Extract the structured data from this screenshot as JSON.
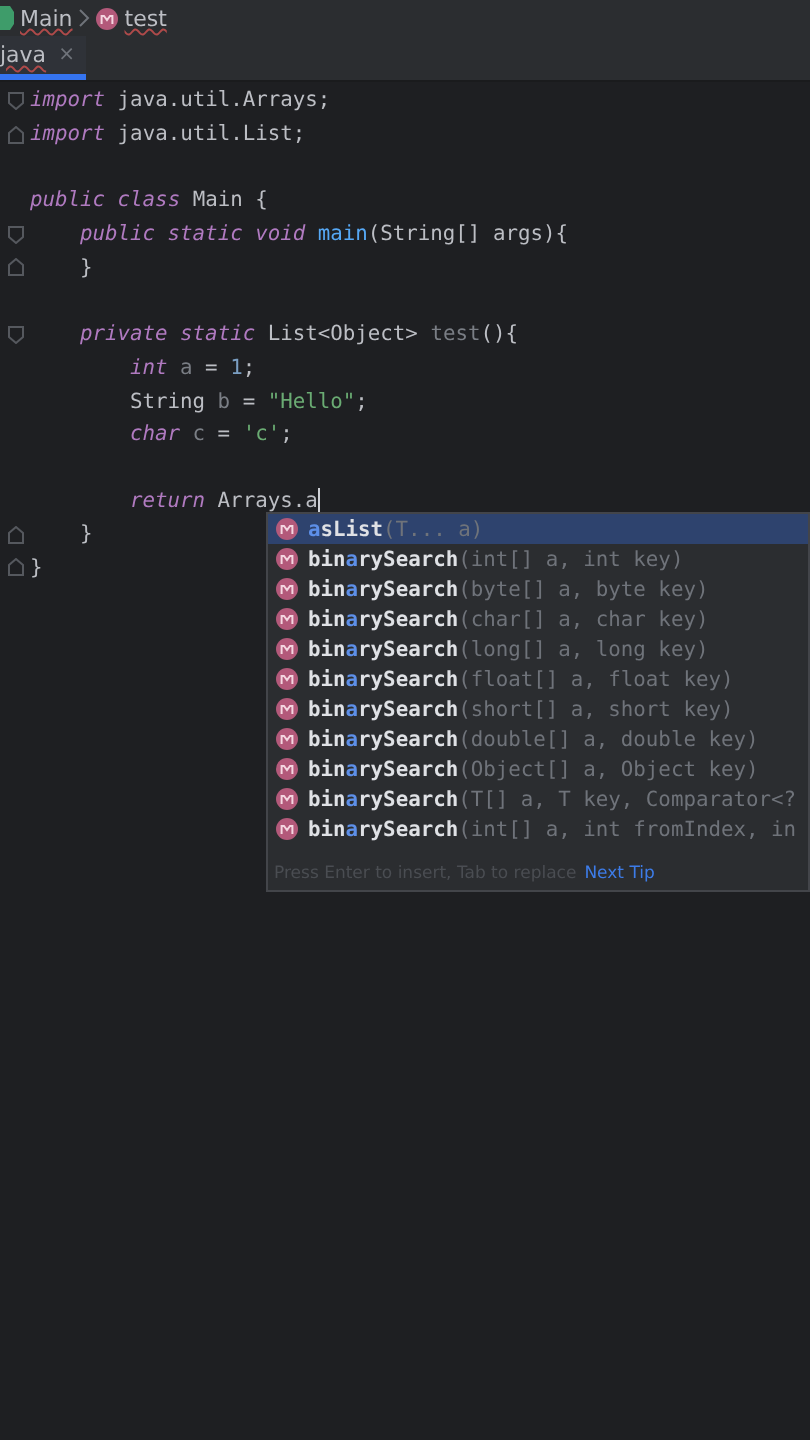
{
  "breadcrumbs": [
    {
      "label": "Main"
    },
    {
      "label": "test"
    }
  ],
  "tabs": [
    {
      "label": "java",
      "close": "×",
      "selected": true
    }
  ],
  "code_lines": [
    {
      "kind": "opener",
      "tokens": [
        {
          "kind": "kw",
          "text": "import"
        },
        {
          "kind": "plain",
          "text": " java.util.Arrays;"
        }
      ]
    },
    {
      "kind": "closer",
      "tokens": [
        {
          "kind": "kw",
          "text": "import"
        },
        {
          "kind": "plain",
          "text": " java.util.List;"
        }
      ]
    },
    {
      "kind": "line",
      "blank_before": true,
      "tokens": [
        {
          "kind": "kw",
          "text": "public class"
        },
        {
          "kind": "plain",
          "text": " Main {"
        }
      ],
      "children": [
        {
          "kind": "opener",
          "tokens": [
            {
              "kind": "kw",
              "text": "public static void "
            },
            {
              "kind": "fn",
              "text": "main"
            },
            {
              "kind": "plain",
              "text": "(String[] args){"
            }
          ]
        },
        {
          "kind": "closer",
          "tokens": [
            {
              "kind": "plain",
              "text": "}"
            }
          ]
        },
        {
          "kind": "opener",
          "blank_before": true,
          "tokens": [
            {
              "kind": "kw",
              "text": "private static"
            },
            {
              "kind": "plain",
              "text": " List<Object> "
            },
            {
              "kind": "unused",
              "text": "test"
            },
            {
              "kind": "plain",
              "text": "(){"
            }
          ],
          "children": [
            {
              "kind": "line",
              "tokens": [
                {
                  "kind": "kw",
                  "text": "int "
                },
                {
                  "kind": "unused",
                  "text": "a"
                },
                {
                  "kind": "plain",
                  "text": " = "
                },
                {
                  "kind": "num",
                  "text": "1"
                },
                {
                  "kind": "plain",
                  "text": ";"
                }
              ]
            },
            {
              "kind": "line",
              "tokens": [
                {
                  "kind": "plain",
                  "text": "String "
                },
                {
                  "kind": "unused",
                  "text": "b"
                },
                {
                  "kind": "plain",
                  "text": " = "
                },
                {
                  "kind": "str",
                  "text": "\"Hello\""
                },
                {
                  "kind": "plain",
                  "text": ";"
                }
              ]
            },
            {
              "kind": "line",
              "tokens": [
                {
                  "kind": "kw",
                  "text": "char "
                },
                {
                  "kind": "unused",
                  "text": "c"
                },
                {
                  "kind": "plain",
                  "text": " = "
                },
                {
                  "kind": "str",
                  "text": "'c'"
                },
                {
                  "kind": "plain",
                  "text": ";"
                }
              ]
            },
            {
              "kind": "line",
              "blank_before": true,
              "caret": true,
              "tokens": [
                {
                  "kind": "kw",
                  "text": "return"
                },
                {
                  "kind": "plain",
                  "text": " Arrays.a"
                }
              ]
            }
          ]
        },
        {
          "kind": "closer",
          "tokens": [
            {
              "kind": "plain",
              "text": "}"
            }
          ]
        }
      ]
    },
    {
      "kind": "closer",
      "tokens": [
        {
          "kind": "plain",
          "text": "}"
        }
      ]
    }
  ],
  "completion": {
    "items": [
      {
        "selected": true,
        "name": [
          {
            "text": "a",
            "matched": true
          },
          {
            "text": "sList",
            "matched": false
          }
        ],
        "params": "(T... a)"
      },
      {
        "selected": false,
        "name": [
          {
            "text": "bin",
            "matched": false
          },
          {
            "text": "a",
            "matched": true
          },
          {
            "text": "rySearch",
            "matched": false
          }
        ],
        "params": "(int[] a, int key)"
      },
      {
        "selected": false,
        "name": [
          {
            "text": "bin",
            "matched": false
          },
          {
            "text": "a",
            "matched": true
          },
          {
            "text": "rySearch",
            "matched": false
          }
        ],
        "params": "(byte[] a, byte key)"
      },
      {
        "selected": false,
        "name": [
          {
            "text": "bin",
            "matched": false
          },
          {
            "text": "a",
            "matched": true
          },
          {
            "text": "rySearch",
            "matched": false
          }
        ],
        "params": "(char[] a, char key)"
      },
      {
        "selected": false,
        "name": [
          {
            "text": "bin",
            "matched": false
          },
          {
            "text": "a",
            "matched": true
          },
          {
            "text": "rySearch",
            "matched": false
          }
        ],
        "params": "(long[] a, long key)"
      },
      {
        "selected": false,
        "name": [
          {
            "text": "bin",
            "matched": false
          },
          {
            "text": "a",
            "matched": true
          },
          {
            "text": "rySearch",
            "matched": false
          }
        ],
        "params": "(float[] a, float key)"
      },
      {
        "selected": false,
        "name": [
          {
            "text": "bin",
            "matched": false
          },
          {
            "text": "a",
            "matched": true
          },
          {
            "text": "rySearch",
            "matched": false
          }
        ],
        "params": "(short[] a, short key)"
      },
      {
        "selected": false,
        "name": [
          {
            "text": "bin",
            "matched": false
          },
          {
            "text": "a",
            "matched": true
          },
          {
            "text": "rySearch",
            "matched": false
          }
        ],
        "params": "(double[] a, double key)"
      },
      {
        "selected": false,
        "name": [
          {
            "text": "bin",
            "matched": false
          },
          {
            "text": "a",
            "matched": true
          },
          {
            "text": "rySearch",
            "matched": false
          }
        ],
        "params": "(Object[] a, Object key)"
      },
      {
        "selected": false,
        "name": [
          {
            "text": "bin",
            "matched": false
          },
          {
            "text": "a",
            "matched": true
          },
          {
            "text": "rySearch",
            "matched": false
          }
        ],
        "params": "(T[] a, T key, Comparator<?"
      },
      {
        "selected": false,
        "name": [
          {
            "text": "bin",
            "matched": false
          },
          {
            "text": "a",
            "matched": true
          },
          {
            "text": "rySearch",
            "matched": false
          }
        ],
        "params": "(int[] a, int fromIndex, in"
      }
    ],
    "hint": "Press Enter to insert, Tab to replace",
    "tip_link": "Next Tip"
  }
}
